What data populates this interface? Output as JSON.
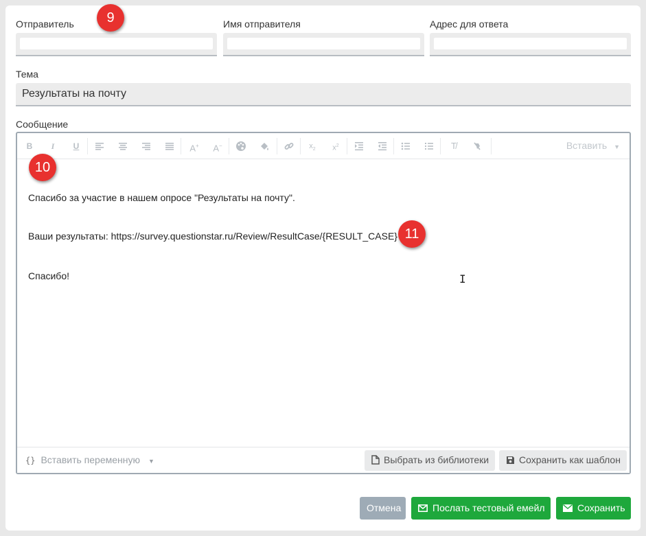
{
  "sender": {
    "sender_label": "Отправитель",
    "sender_name_label": "Имя отправителя",
    "reply_to_label": "Адрес для ответа"
  },
  "subject": {
    "label": "Тема",
    "value": "Результаты на почту"
  },
  "message": {
    "label": "Сообщение",
    "toolbar": {
      "insert_dropdown": "Вставить",
      "buttons": [
        "bold-icon",
        "italic-icon",
        "underline-icon",
        "align-left-icon",
        "align-center-icon",
        "align-right-icon",
        "align-justify-icon",
        "font-size-increase-icon",
        "font-size-decrease-icon",
        "palette-icon",
        "fill-color-icon",
        "link-icon",
        "subscript-icon",
        "superscript-icon",
        "indent-icon",
        "outdent-icon",
        "bullet-list-icon",
        "numbered-list-icon",
        "clear-format-icon",
        "no-format-icon"
      ]
    },
    "body": {
      "line1": "Спасибо за участие в нашем опросе \"Результаты на почту\".",
      "line2": "Ваши результаты: https://survey.questionstar.ru/Review/ResultCase/{RESULT_CASE}",
      "line3": "Спасибо!"
    },
    "footer": {
      "insert_variable": "Вставить переменную",
      "choose_library": "Выбрать из библиотеки",
      "save_template": "Сохранить как шаблон"
    }
  },
  "actions": {
    "cancel": "Отмена",
    "send_test": "Послать тестовый емейл",
    "save": "Сохранить"
  },
  "annotations": {
    "badge_9": "9",
    "badge_10": "10",
    "badge_11": "11"
  },
  "colors": {
    "badge_red": "#e8312f",
    "primary_green": "#1ea83c",
    "cancel_gray": "#9eabb6"
  }
}
